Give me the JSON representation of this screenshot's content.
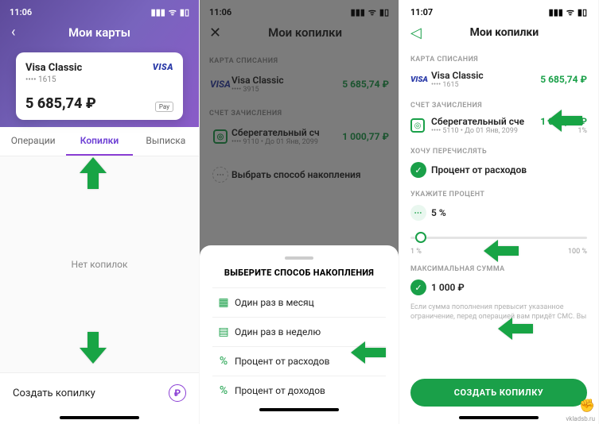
{
  "phone1": {
    "time": "11:06",
    "title": "Мои карты",
    "card": {
      "name": "Visa Classic",
      "brand": "VISA",
      "mask": "•••• 1615",
      "balance": "5 685,74 ₽",
      "pay_label": "Pay"
    },
    "tabs": {
      "t1": "Операции",
      "t2": "Копилки",
      "t3": "Выписка"
    },
    "empty": "Нет копилок",
    "footer": "Создать копилку",
    "rub": "₽"
  },
  "phone2": {
    "time": "11:06",
    "title": "Мои копилки",
    "sec_from": "КАРТА СПИСАНИЯ",
    "card": {
      "brand": "VISA",
      "name": "Visa Classic",
      "mask": "•••• 3915",
      "balance": "5 685,74 ₽"
    },
    "sec_to": "СЧЕТ ЗАЧИСЛЕНИЯ",
    "acct": {
      "name": "Сберегательный сч",
      "sub": "•••• 9110 • До 01 Янв, 2099",
      "balance": "1 000,77 ₽"
    },
    "choose": "Выбрать способ накопления",
    "sheet": {
      "title": "ВЫБЕРИТЕ СПОСОБ НАКОПЛЕНИЯ",
      "o1": "Один раз в месяц",
      "o2": "Один раз в неделю",
      "o3": "Процент от расходов",
      "o4": "Процент от доходов"
    }
  },
  "phone3": {
    "time": "11:07",
    "title": "Мои копилки",
    "sec_from": "КАРТА СПИСАНИЯ",
    "card": {
      "brand": "VISA",
      "name": "Visa Classic",
      "mask": "•••• 1615",
      "balance": "5 685,74 ₽"
    },
    "sec_to": "СЧЕТ ЗАЧИСЛЕНИЯ",
    "acct": {
      "name": "Сберегательный сче",
      "sub": "•••• 5110 • До 01 Янв, 2099",
      "balance": "1 000,77 ₽",
      "pct": "1%"
    },
    "sec_method": "ХОЧУ ПЕРЕЧИСЛЯТЬ",
    "method": "Процент от расходов",
    "sec_pct": "УКАЖИТЕ ПРОЦЕНТ",
    "pct_val": "5 %",
    "pct_min": "1 %",
    "pct_max": "100 %",
    "sec_max": "МАКСИМАЛЬНАЯ СУММА",
    "max_val": "1 000 ₽",
    "hint": "Если сумма пополнения превысит указанное ограничение, перед операцией вам придёт СМС. Вы",
    "cta": "СОЗДАТЬ КОПИЛКУ"
  },
  "watermark": "vkladsb.ru"
}
